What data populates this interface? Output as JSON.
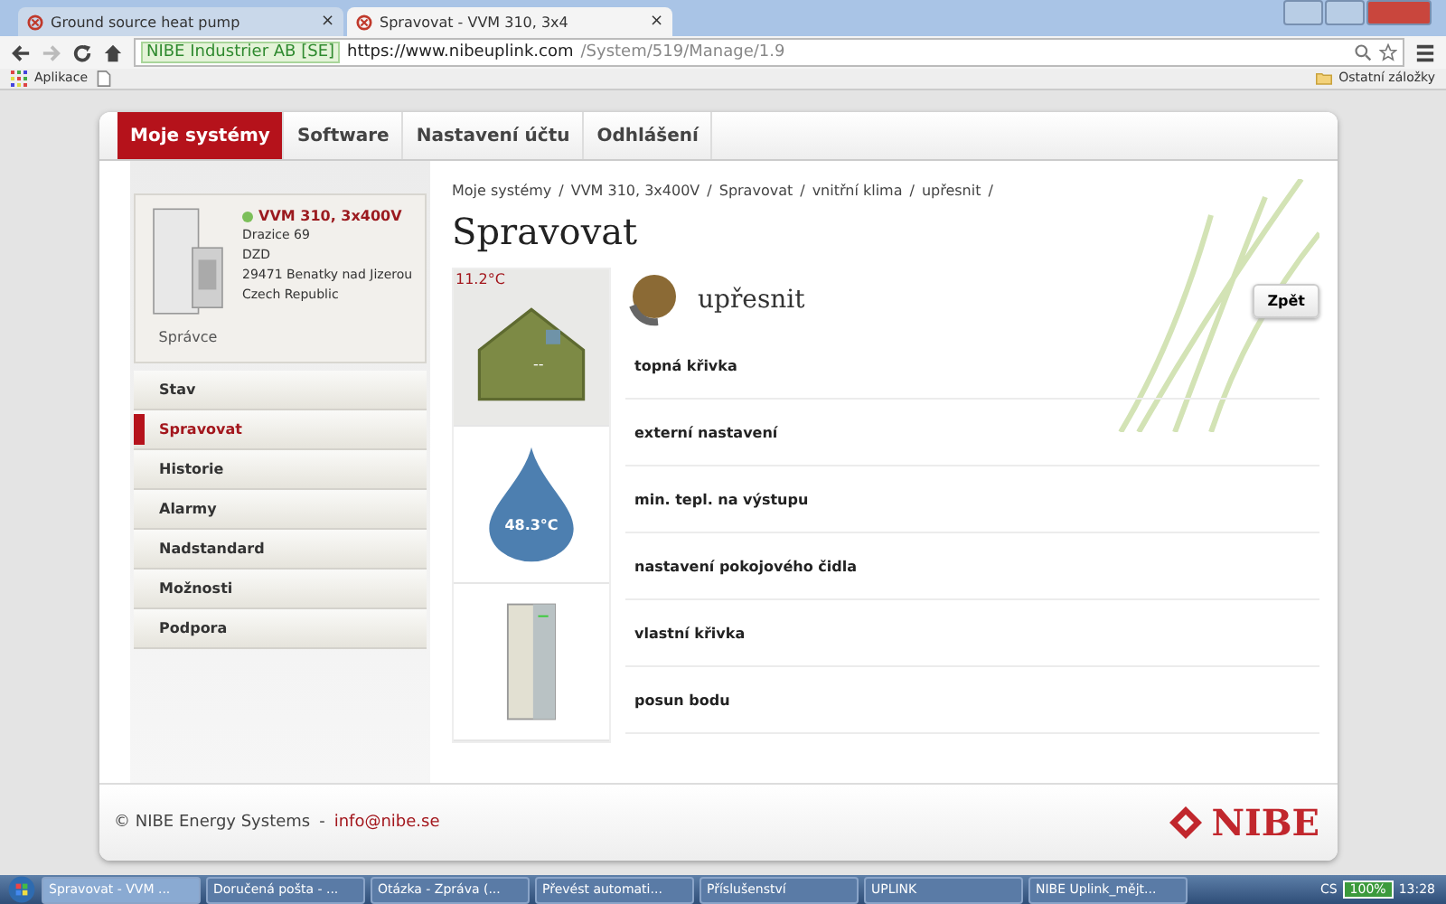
{
  "browser": {
    "tabs": [
      {
        "label": "Ground source heat pump",
        "selected": false
      },
      {
        "label": "Spravovat - VVM 310, 3x4",
        "selected": true
      }
    ],
    "security_label": "NIBE Industrier AB [SE]",
    "url_host": "https://www.nibeuplink.com",
    "url_path": "/System/519/Manage/1.9",
    "tab_close": "×",
    "bookmarks": [
      "Aplikace"
    ],
    "other_bookmarks": "Ostatní záložky"
  },
  "nav": [
    {
      "label": "Moje systémy",
      "selected": true
    },
    {
      "label": "Software",
      "selected": false
    },
    {
      "label": "Nastavení účtu",
      "selected": false
    },
    {
      "label": "Odhlášení",
      "selected": false
    }
  ],
  "system": {
    "name": "VVM 310, 3x400V",
    "online": true,
    "address": [
      "Drazice 69",
      "DZD",
      "29471 Benatky nad Jizerou",
      "Czech Republic"
    ],
    "role": "Správce"
  },
  "sidebar": [
    {
      "label": "Stav",
      "selected": false
    },
    {
      "label": "Spravovat",
      "selected": true
    },
    {
      "label": "Historie",
      "selected": false
    },
    {
      "label": "Alarmy",
      "selected": false
    },
    {
      "label": "Nadstandard",
      "selected": false
    },
    {
      "label": "Možnosti",
      "selected": false
    },
    {
      "label": "Podpora",
      "selected": false
    }
  ],
  "breadcrumb_separator": "/",
  "breadcrumb": [
    "Moje systémy",
    "VVM 310, 3x400V",
    "Spravovat",
    "vnitřní klima",
    "upřesnit"
  ],
  "title": "Spravovat",
  "tiles": [
    {
      "kind": "house",
      "reading": "11.2°C",
      "value": "--"
    },
    {
      "kind": "drop",
      "value": "48.3°C"
    },
    {
      "kind": "unit"
    }
  ],
  "section_title": "upřesnit",
  "back_button": "Zpět",
  "menu": [
    "topná křivka",
    "externí nastavení",
    "min. tepl. na výstupu",
    "nastavení pokojového čidla",
    "vlastní křivka",
    "posun bodu"
  ],
  "footer": {
    "copyright": "© NIBE Energy Systems",
    "separator": "-",
    "email": "info@nibe.se",
    "logo": "NIBE"
  },
  "taskbar": {
    "items": [
      {
        "label": "Spravovat - VVM ...",
        "selected": true
      },
      {
        "label": "Doručená pošta - ...",
        "selected": false
      },
      {
        "label": "Otázka - Zpráva (...",
        "selected": false
      },
      {
        "label": "Převést automati...",
        "selected": false
      },
      {
        "label": "Příslušenství",
        "selected": false
      },
      {
        "label": "UPLINK",
        "selected": false
      },
      {
        "label": "NIBE Uplink_mějt...",
        "selected": false
      }
    ],
    "language": "CS",
    "battery": "100%",
    "time": "13:28"
  }
}
